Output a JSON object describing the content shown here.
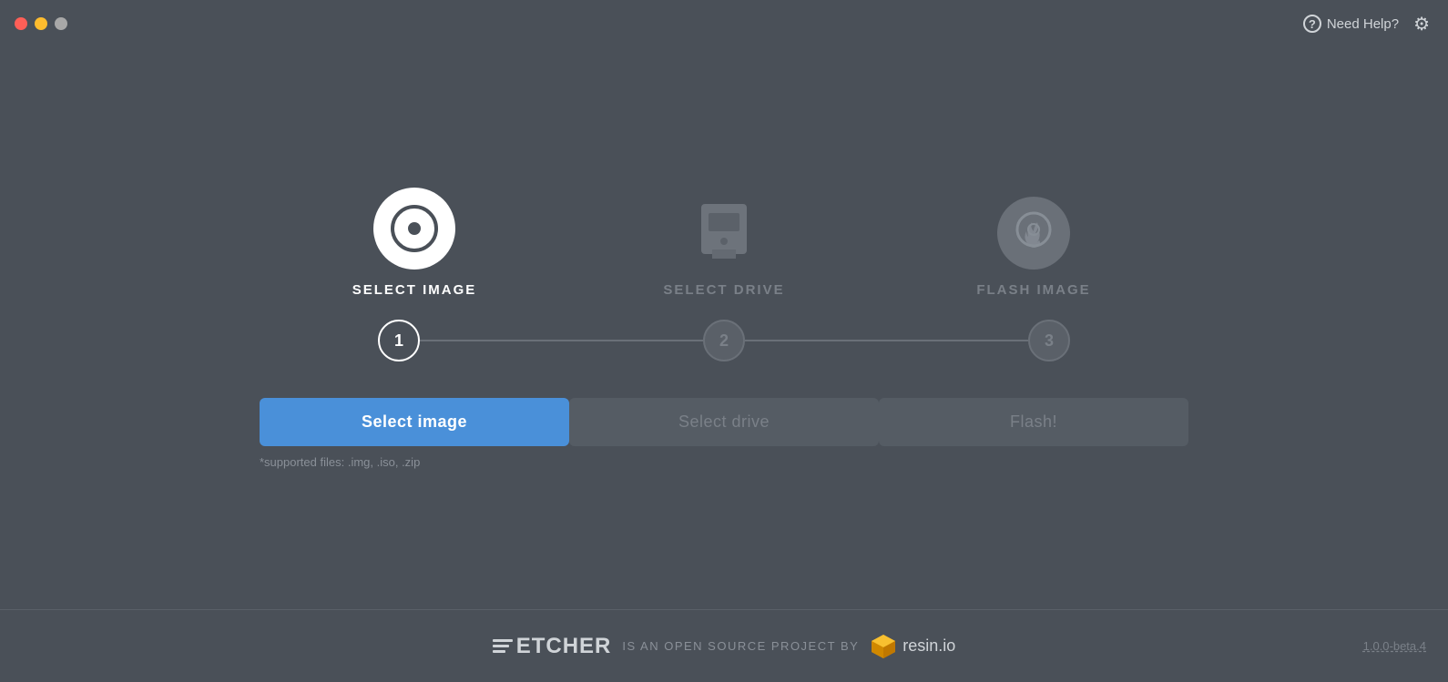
{
  "titleBar": {
    "helpLabel": "Need Help?",
    "trafficLights": {
      "close": "close",
      "minimize": "minimize",
      "maximize": "maximize"
    }
  },
  "steps": [
    {
      "id": 1,
      "iconType": "disc",
      "label": "SELECT IMAGE",
      "active": true,
      "stepNumber": "1"
    },
    {
      "id": 2,
      "iconType": "drive",
      "label": "SELECT DRIVE",
      "active": false,
      "stepNumber": "2"
    },
    {
      "id": 3,
      "iconType": "flash",
      "label": "FLASH IMAGE",
      "active": false,
      "stepNumber": "3"
    }
  ],
  "buttons": {
    "selectImage": "Select image",
    "selectDrive": "Select drive",
    "flash": "Flash!",
    "supportedFiles": "*supported files: .img, .iso, .zip"
  },
  "footer": {
    "etcherLabel": "ETCHER",
    "description": "IS AN OPEN SOURCE PROJECT BY",
    "resinLabel": "resin.io",
    "version": "1.0.0-beta.4"
  }
}
